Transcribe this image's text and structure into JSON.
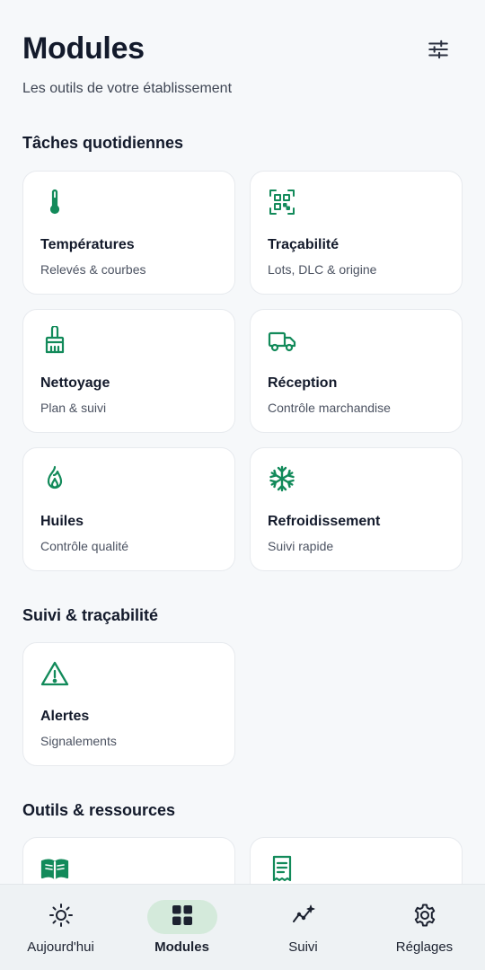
{
  "header": {
    "title": "Modules",
    "subtitle": "Les outils de votre établissement",
    "filter_icon": "sliders-icon"
  },
  "sections": {
    "daily": {
      "title": "Tâches quotidiennes",
      "cards": [
        {
          "title": "Températures",
          "subtitle": "Relevés & courbes",
          "icon": "thermometer-icon"
        },
        {
          "title": "Traçabilité",
          "subtitle": "Lots, DLC & origine",
          "icon": "qr-code-icon"
        },
        {
          "title": "Nettoyage",
          "subtitle": "Plan & suivi",
          "icon": "broom-icon"
        },
        {
          "title": "Réception",
          "subtitle": "Contrôle marchandise",
          "icon": "truck-icon"
        },
        {
          "title": "Huiles",
          "subtitle": "Contrôle qualité",
          "icon": "flame-icon"
        },
        {
          "title": "Refroidissement",
          "subtitle": "Suivi rapide",
          "icon": "snowflake-icon"
        }
      ]
    },
    "tracking": {
      "title": "Suivi & traçabilité",
      "cards": [
        {
          "title": "Alertes",
          "subtitle": "Signalements",
          "icon": "warning-icon"
        }
      ]
    },
    "tools": {
      "title": "Outils & ressources",
      "cards": [
        {
          "icon": "book-icon"
        },
        {
          "icon": "receipt-icon"
        }
      ]
    }
  },
  "bottom_nav": {
    "items": [
      {
        "label": "Aujourd'hui",
        "icon": "sun-icon"
      },
      {
        "label": "Modules",
        "icon": "grid-icon",
        "active": true
      },
      {
        "label": "Suivi",
        "icon": "trend-icon"
      },
      {
        "label": "Réglages",
        "icon": "gear-icon"
      }
    ]
  },
  "colors": {
    "accent": "#128a5a",
    "background": "#f6f8fa",
    "active_pill": "#d4eadb"
  }
}
